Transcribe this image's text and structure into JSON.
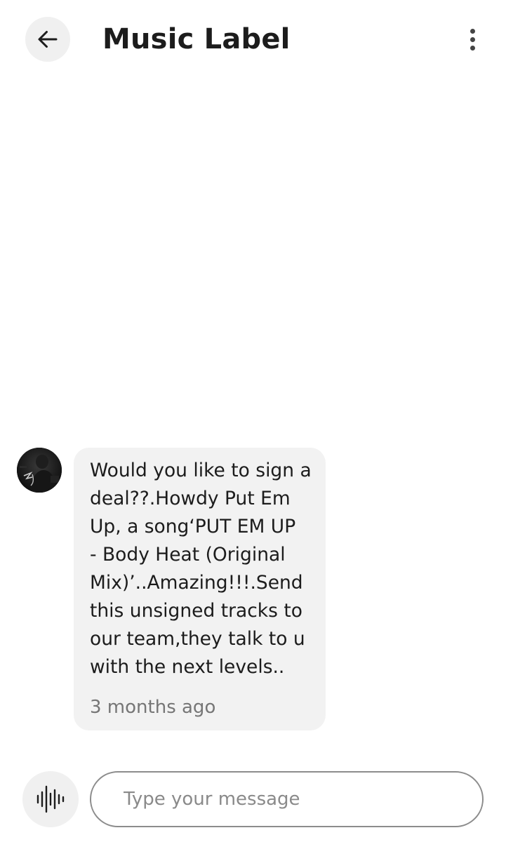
{
  "header": {
    "title": "Music Label",
    "back_icon": "arrow-left-icon",
    "menu_icon": "more-vertical-icon"
  },
  "messages": [
    {
      "direction": "incoming",
      "avatar_icon": "sender-avatar",
      "text": "Would you like to sign a\ndeal??.Howdy Put Em\nUp, a song‘PUT EM UP\n- Body Heat (Original\nMix)’..Amazing!!!.Send\nthis unsigned tracks to\nour team,they talk to u\nwith the next levels..",
      "time": "3 months ago"
    }
  ],
  "composer": {
    "voice_icon": "voice-waveform-icon",
    "placeholder": "Type your message",
    "value": ""
  },
  "colors": {
    "background": "#ffffff",
    "bubble": "#f2f2f2",
    "button_bg": "#f0f0f0",
    "text": "#1c1c1c",
    "muted": "#767676"
  }
}
